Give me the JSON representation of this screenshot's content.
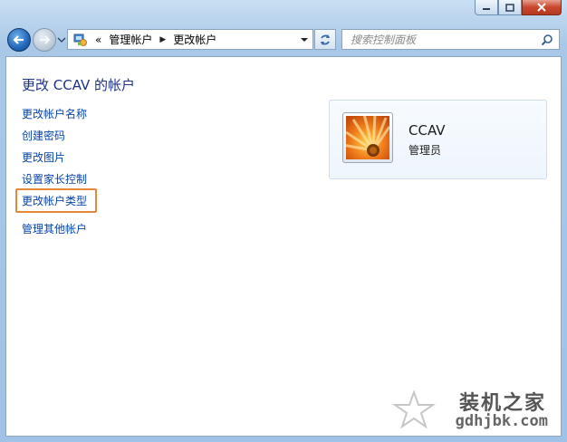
{
  "window": {
    "caption_buttons": [
      "minimize",
      "maximize",
      "close"
    ]
  },
  "navbar": {
    "breadcrumb": {
      "overflow": "«",
      "segments": [
        "管理帐户",
        "更改帐户"
      ]
    },
    "search_placeholder": "搜索控制面板"
  },
  "content": {
    "title": "更改 CCAV 的帐户",
    "links": [
      "更改帐户名称",
      "创建密码",
      "更改图片",
      "设置家长控制",
      "更改帐户类型",
      "管理其他帐户"
    ],
    "highlighted_link_index": 4,
    "highlight_color": "#e7873a",
    "account": {
      "name": "CCAV",
      "role": "管理员",
      "avatar_icon": "orange-flower-picture"
    }
  },
  "watermark": {
    "brand": "装机之家",
    "url": "gdhjbk.com"
  },
  "colors": {
    "link": "#0645ad",
    "title": "#1e3287",
    "frame": "#9fc2e6"
  }
}
